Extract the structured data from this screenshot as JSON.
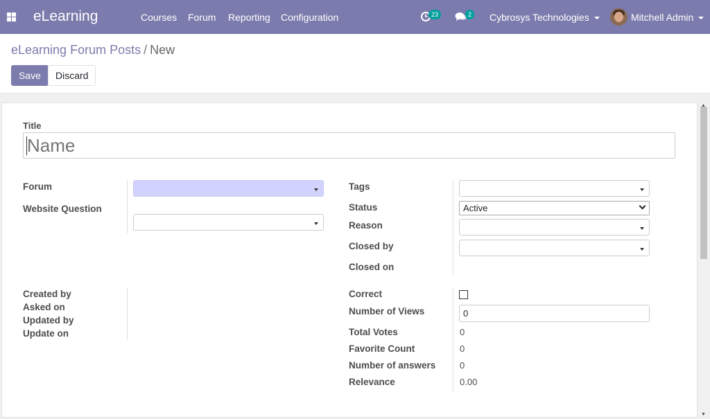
{
  "navbar": {
    "brand": "eLearning",
    "menu": [
      "Courses",
      "Forum",
      "Reporting",
      "Configuration"
    ],
    "activity_count": "23",
    "message_count": "2",
    "company": "Cybrosys Technologies",
    "user": "Mitchell Admin",
    "brand_color": "#7c7bad",
    "badge_color": "#00a09d"
  },
  "breadcrumb": {
    "parent": "eLearning Forum Posts",
    "separator": "/",
    "current": "New"
  },
  "buttons": {
    "save": "Save",
    "discard": "Discard"
  },
  "form": {
    "title_label": "Title",
    "title_placeholder": "Name",
    "left": {
      "forum_label": "Forum",
      "website_question_label": "Website Question",
      "created_by_label": "Created by",
      "asked_on_label": "Asked on",
      "updated_by_label": "Updated by",
      "update_on_label": "Update on"
    },
    "right": {
      "tags_label": "Tags",
      "status_label": "Status",
      "status_value": "Active",
      "reason_label": "Reason",
      "closed_by_label": "Closed by",
      "closed_on_label": "Closed on",
      "correct_label": "Correct",
      "views_label": "Number of Views",
      "views_value": "0",
      "votes_label": "Total Votes",
      "votes_value": "0",
      "favorite_label": "Favorite Count",
      "favorite_value": "0",
      "answers_label": "Number of answers",
      "answers_value": "0",
      "relevance_label": "Relevance",
      "relevance_value": "0.00"
    }
  }
}
